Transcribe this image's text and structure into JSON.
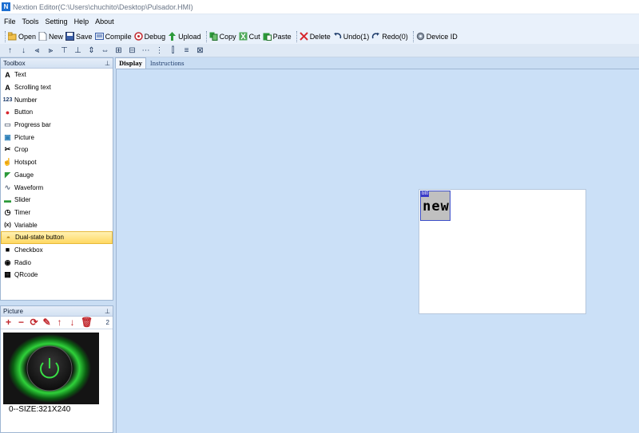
{
  "window": {
    "title": "Nextion Editor(C:\\Users\\chuchito\\Desktop\\Pulsador.HMI)"
  },
  "menu": [
    "File",
    "Tools",
    "Setting",
    "Help",
    "About"
  ],
  "toolbar": {
    "open": "Open",
    "new": "New",
    "save": "Save",
    "compile": "Compile",
    "debug": "Debug",
    "upload": "Upload",
    "copy": "Copy",
    "cut": "Cut",
    "paste": "Paste",
    "delete": "Delete",
    "undo": "Undo(1)",
    "redo": "Redo(0)",
    "device_id": "Device  ID"
  },
  "toolbox": {
    "title": "Toolbox",
    "items": [
      {
        "label": "Text",
        "icon": "text-icon"
      },
      {
        "label": "Scrolling text",
        "icon": "scrolling-text-icon"
      },
      {
        "label": "Number",
        "icon": "number-icon"
      },
      {
        "label": "Button",
        "icon": "button-icon"
      },
      {
        "label": "Progress bar",
        "icon": "progress-bar-icon"
      },
      {
        "label": "Picture",
        "icon": "picture-icon"
      },
      {
        "label": "Crop",
        "icon": "crop-icon"
      },
      {
        "label": "Hotspot",
        "icon": "hotspot-icon"
      },
      {
        "label": "Gauge",
        "icon": "gauge-icon"
      },
      {
        "label": "Waveform",
        "icon": "waveform-icon"
      },
      {
        "label": "Slider",
        "icon": "slider-icon"
      },
      {
        "label": "Timer",
        "icon": "timer-icon"
      },
      {
        "label": "Variable",
        "icon": "variable-icon"
      },
      {
        "label": "Dual-state button",
        "icon": "dual-state-button-icon",
        "selected": true
      },
      {
        "label": "Checkbox",
        "icon": "checkbox-icon"
      },
      {
        "label": "Radio",
        "icon": "radio-icon"
      },
      {
        "label": "QRcode",
        "icon": "qrcode-icon"
      }
    ]
  },
  "picture_panel": {
    "title": "Picture",
    "count": "2",
    "image_caption": "0--SIZE:321X240"
  },
  "tabs": [
    {
      "label": "Display",
      "active": true
    },
    {
      "label": "Instructions",
      "active": false
    }
  ],
  "hmi": {
    "component_id": "bt0",
    "component_text": "new"
  },
  "colors": {
    "accent": "#1d6fd1",
    "selection": "#ffd862",
    "canvas_bg": "#cbe0f7",
    "component_border": "#3c4fc9"
  }
}
